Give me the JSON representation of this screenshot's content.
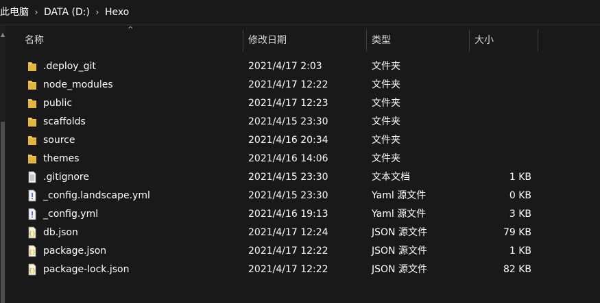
{
  "breadcrumb": {
    "items": [
      "此电脑",
      "DATA (D:)",
      "Hexo"
    ],
    "separator": "›"
  },
  "columns": {
    "name": "名称",
    "date": "修改日期",
    "type": "类型",
    "size": "大小"
  },
  "colors": {
    "background": "#191919",
    "folder": "#f2c94c",
    "json_icon": "#c9b74a",
    "text": "#ffffff"
  },
  "files": [
    {
      "name": ".deploy_git",
      "date": "2021/4/17 2:03",
      "type": "文件夹",
      "size": "",
      "icon": "folder-icon"
    },
    {
      "name": "node_modules",
      "date": "2021/4/17 12:22",
      "type": "文件夹",
      "size": "",
      "icon": "folder-icon"
    },
    {
      "name": "public",
      "date": "2021/4/17 12:23",
      "type": "文件夹",
      "size": "",
      "icon": "folder-icon"
    },
    {
      "name": "scaffolds",
      "date": "2021/4/15 23:30",
      "type": "文件夹",
      "size": "",
      "icon": "folder-icon"
    },
    {
      "name": "source",
      "date": "2021/4/16 20:34",
      "type": "文件夹",
      "size": "",
      "icon": "folder-icon"
    },
    {
      "name": "themes",
      "date": "2021/4/16 14:06",
      "type": "文件夹",
      "size": "",
      "icon": "folder-icon"
    },
    {
      "name": ".gitignore",
      "date": "2021/4/15 23:30",
      "type": "文本文档",
      "size": "1 KB",
      "icon": "text-file-icon"
    },
    {
      "name": "_config.landscape.yml",
      "date": "2021/4/15 23:30",
      "type": "Yaml 源文件",
      "size": "0 KB",
      "icon": "yaml-file-icon"
    },
    {
      "name": "_config.yml",
      "date": "2021/4/16 19:13",
      "type": "Yaml 源文件",
      "size": "3 KB",
      "icon": "yaml-file-icon"
    },
    {
      "name": "db.json",
      "date": "2021/4/17 12:24",
      "type": "JSON 源文件",
      "size": "79 KB",
      "icon": "json-file-icon"
    },
    {
      "name": "package.json",
      "date": "2021/4/17 12:22",
      "type": "JSON 源文件",
      "size": "1 KB",
      "icon": "json-file-icon"
    },
    {
      "name": "package-lock.json",
      "date": "2021/4/17 12:22",
      "type": "JSON 源文件",
      "size": "82 KB",
      "icon": "json-file-icon"
    }
  ]
}
